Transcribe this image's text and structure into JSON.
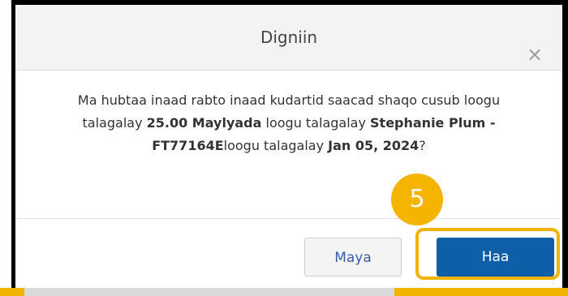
{
  "dialog": {
    "title": "Digniin",
    "close_symbol": "×",
    "message": {
      "part1": "Ma hubtaa inaad rabto inaad kudartid saacad shaqo cusub loogu talagalay ",
      "hours": "25.00 Maylyada",
      "part2": " loogu talagalay ",
      "person": "Stephanie Plum - FT77164E",
      "part3": "loogu talagalay ",
      "date": "Jan 05, 2024",
      "part4": "?"
    },
    "buttons": {
      "no_label": "Maya",
      "yes_label": "Haa"
    }
  },
  "annotation": {
    "step_number": "5",
    "color": "#f0b400"
  },
  "colors": {
    "primary_button": "#0f5ea8",
    "header_bg": "#f3f3f3"
  }
}
